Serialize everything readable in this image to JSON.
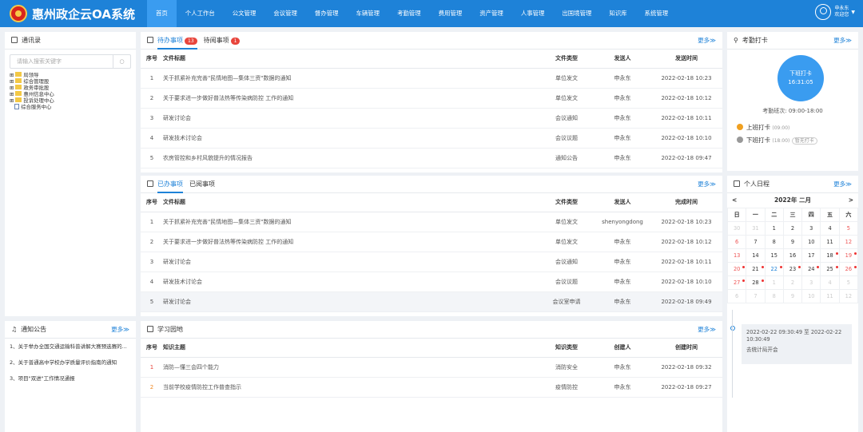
{
  "header": {
    "title": "惠州政企云OA系统",
    "nav": [
      "首页",
      "个人工作台",
      "公文管理",
      "会议管理",
      "督办管理",
      "车辆管理",
      "考勤管理",
      "费用管理",
      "资产管理",
      "人事管理",
      "出国境管理",
      "知识库",
      "系统管理"
    ],
    "user_name": "申永东",
    "user_greeting": "欢迎您"
  },
  "contacts": {
    "title": "通讯录",
    "search_placeholder": "请输入搜索关键字",
    "tree": [
      "局领导",
      "综合管理股",
      "政务审批股",
      "惠州信息中心",
      "投诉处理中心",
      "综合服务中心"
    ]
  },
  "notices": {
    "title": "通知公告",
    "more": "更多≫",
    "items": [
      "1、关于举办全国交通运输科普讲解大赛预选赛的...",
      "2、关于普通高中学校办学质量评价指南的通知",
      "3、项目\"双进\"工作情况通报"
    ]
  },
  "todo": {
    "tab1": "待办事项",
    "tab1_count": "13",
    "tab2": "待阅事项",
    "tab2_count": "1",
    "more": "更多≫",
    "headers": [
      "序号",
      "文件标题",
      "文件类型",
      "发送人",
      "发送时间"
    ],
    "rows": [
      [
        "1",
        "关于抓紧补充完善\"民情地图—集体三资\"数据的通知",
        "单位发文",
        "申永东",
        "2022-02-18 10:23"
      ],
      [
        "2",
        "关于要求进一步做好普法热等传染病防控 工作的通知",
        "单位发文",
        "申永东",
        "2022-02-18 10:12"
      ],
      [
        "3",
        "研发讨论会",
        "会议通知",
        "申永东",
        "2022-02-18 10:11"
      ],
      [
        "4",
        "研发技术讨论会",
        "会议议题",
        "申永东",
        "2022-02-18 10:10"
      ],
      [
        "5",
        "农房管控和乡村风貌提升的情况报告",
        "通知公告",
        "申永东",
        "2022-02-18 09:47"
      ]
    ]
  },
  "done": {
    "tab1": "已办事项",
    "tab2": "已阅事项",
    "more": "更多≫",
    "headers": [
      "序号",
      "文件标题",
      "文件类型",
      "发送人",
      "完成时间"
    ],
    "rows": [
      [
        "1",
        "关于抓紧补充完善\"民情地图—集体三资\"数据的通知",
        "单位发文",
        "shenyongdong",
        "2022-02-18 10:23"
      ],
      [
        "2",
        "关于要求进一步做好普法热等传染病防控 工作的通知",
        "单位发文",
        "申永东",
        "2022-02-18 10:12"
      ],
      [
        "3",
        "研发讨论会",
        "会议通知",
        "申永东",
        "2022-02-18 10:11"
      ],
      [
        "4",
        "研发技术讨论会",
        "会议议题",
        "申永东",
        "2022-02-18 10:10"
      ],
      [
        "5",
        "研发讨论会",
        "会议室申请",
        "申永东",
        "2022-02-18 09:49"
      ]
    ]
  },
  "study": {
    "title": "学习园地",
    "more": "更多≫",
    "headers": [
      "序号",
      "知识主题",
      "知识类型",
      "创建人",
      "创建时间"
    ],
    "rows": [
      [
        "1",
        "消防—懂三会四个能力",
        "消防安全",
        "申永东",
        "2022-02-18 09:32"
      ],
      [
        "2",
        "当前学校疫情防控工作普查指示",
        "疫情防控",
        "申永东",
        "2022-02-18 09:27"
      ]
    ]
  },
  "attendance": {
    "title": "考勤打卡",
    "more": "更多≫",
    "clock_label": "下班打卡",
    "clock_time": "16:31:05",
    "shift": "考勤班次:   09:00-18:00",
    "on_label": "上班打卡",
    "on_time": "(09:00)",
    "off_label": "下班打卡",
    "off_time": "(18:00)",
    "off_status": "暂无打卡"
  },
  "calendar": {
    "title": "个人日程",
    "more": "更多≫",
    "month": "2022年 二月",
    "prev": "<",
    "next": ">",
    "weekdays": [
      "日",
      "一",
      "二",
      "三",
      "四",
      "五",
      "六"
    ],
    "weeks": [
      [
        "30",
        "31",
        "1",
        "2",
        "3",
        "4",
        "5"
      ],
      [
        "6",
        "7",
        "8",
        "9",
        "10",
        "11",
        "12"
      ],
      [
        "13",
        "14",
        "15",
        "16",
        "17",
        "18",
        "19"
      ],
      [
        "20",
        "21",
        "22",
        "23",
        "24",
        "25",
        "26"
      ],
      [
        "27",
        "28",
        "1",
        "2",
        "3",
        "4",
        "5"
      ],
      [
        "6",
        "7",
        "8",
        "9",
        "10",
        "11",
        "12"
      ]
    ],
    "event_time": "2022-02-22 09:30:49 至 2022-02-22 10:30:49",
    "event_title": "去统计局开会"
  }
}
